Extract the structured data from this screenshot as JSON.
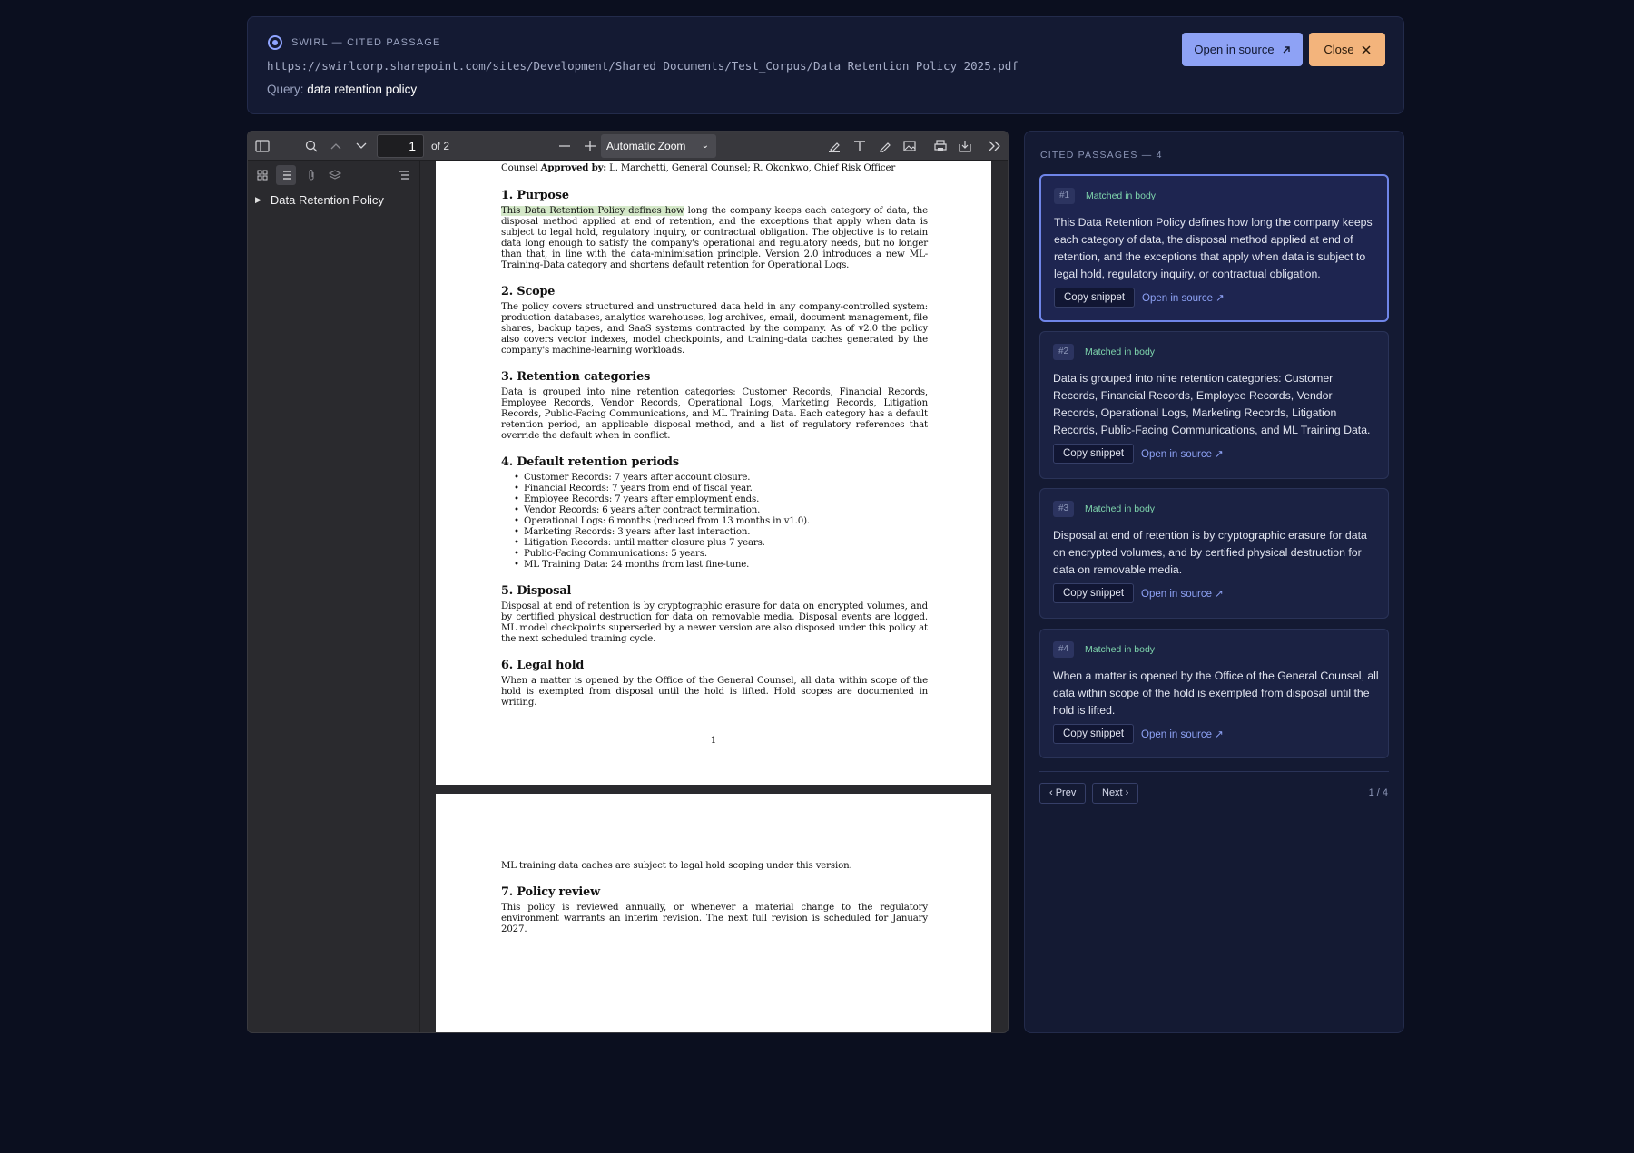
{
  "header": {
    "brand": "SWIRL — CITED PASSAGE",
    "url": "https://swirlcorp.sharepoint.com/sites/Development/Shared Documents/Test_Corpus/Data Retention Policy 2025.pdf",
    "query_label": "Query:",
    "query_value": "data retention policy",
    "open_in_source": "Open in source",
    "close": "Close"
  },
  "viewer": {
    "page_number": "1",
    "page_of": "of 2",
    "zoom": "Automatic Zoom",
    "outline": [
      "Data Retention Policy"
    ]
  },
  "pdf": {
    "page1_top_line": "Counsel",
    "page1_top_bold": "Approved by:",
    "page1_top_rest": " L. Marchetti, General Counsel; R. Okonkwo, Chief Risk Officer",
    "sections": [
      {
        "heading": "1.  Purpose",
        "highlight": "This Data Retention Policy defines how",
        "text": " long the company keeps each category of data, the disposal method applied at end of retention, and the exceptions that apply when data is subject to legal hold, regulatory inquiry, or contractual obligation.  The objective is to retain data long enough to satisfy the company's operational and regulatory needs, but no longer than that, in line with the data-minimisation principle.  Version 2.0 introduces a new ML-Training-Data category and shortens default retention for Operational Logs."
      },
      {
        "heading": "2.  Scope",
        "text": "The policy covers structured and unstructured data held in any company-controlled system: production databases, analytics warehouses, log archives, email, document management, file shares, backup tapes, and SaaS systems contracted by the company.  As of v2.0 the policy also covers vector indexes, model checkpoints, and training-data caches generated by the company's machine-learning workloads."
      },
      {
        "heading": "3.  Retention categories",
        "text": "Data is grouped into nine retention categories:  Customer Records, Financial Records, Employee Records, Vendor Records, Operational Logs, Marketing Records, Litigation Records, Public-Facing Communications, and ML Training Data.  Each category has a default retention period, an applicable disposal method, and a list of regulatory references that override the default when in conflict."
      },
      {
        "heading": "4.  Default retention periods",
        "bullets": [
          "Customer Records: 7 years after account closure.",
          "Financial Records: 7 years from end of fiscal year.",
          "Employee Records: 7 years after employment ends.",
          "Vendor Records: 6 years after contract termination.",
          "Operational Logs: 6 months (reduced from 13 months in v1.0).",
          "Marketing Records: 3 years after last interaction.",
          "Litigation Records: until matter closure plus 7 years.",
          "Public-Facing Communications: 5 years.",
          "ML Training Data: 24 months from last fine-tune."
        ]
      },
      {
        "heading": "5.  Disposal",
        "text": "Disposal at end of retention is by cryptographic erasure for data on encrypted volumes, and by certified physical destruction for data on removable media.  Disposal events are logged.  ML model checkpoints superseded by a newer version are also disposed under this policy at the next scheduled training cycle."
      },
      {
        "heading": "6.  Legal hold",
        "text": "When a matter is opened by the Office of the General Counsel, all data within scope of the hold is exempted from disposal until the hold is lifted.  Hold scopes are documented in writing."
      }
    ],
    "page1_number": "1",
    "page2_intro": "ML training data caches are subject to legal hold scoping under this version.",
    "page2_heading": "7.  Policy review",
    "page2_text": "This policy is reviewed annually, or whenever a material change to the regulatory environment warrants an interim revision.  The next full revision is scheduled for January 2027."
  },
  "panel": {
    "title": "CITED PASSAGES — 4",
    "passages": [
      {
        "num": "#1",
        "match": "Matched in body",
        "text": "This Data Retention Policy defines how long the company keeps each category of data, the disposal method applied at end of retention, and the exceptions that apply when data is subject to legal hold, regulatory inquiry, or contractual obligation.",
        "copy": "Copy snippet",
        "open": "Open in source ↗"
      },
      {
        "num": "#2",
        "match": "Matched in body",
        "text": "Data is grouped into nine retention categories: Customer Records, Financial Records, Employee Records, Vendor Records, Operational Logs, Marketing Records, Litigation Records, Public-Facing Communications, and ML Training Data.",
        "copy": "Copy snippet",
        "open": "Open in source ↗"
      },
      {
        "num": "#3",
        "match": "Matched in body",
        "text": "Disposal at end of retention is by cryptographic erasure for data on encrypted volumes, and by certified physical destruction for data on removable media.",
        "copy": "Copy snippet",
        "open": "Open in source ↗"
      },
      {
        "num": "#4",
        "match": "Matched in body",
        "text": "When a matter is opened by the Office of the General Counsel, all data within scope of the hold is exempted from disposal until the hold is lifted.",
        "copy": "Copy snippet",
        "open": "Open in source ↗"
      }
    ],
    "prev": "‹ Prev",
    "next": "Next ›",
    "counter": "1 / 4"
  },
  "icons": {
    "brand": "swirl-logo-icon",
    "open_external": "arrow-up-right-icon",
    "close": "x-icon"
  },
  "colors": {
    "background": "#0b0f1f",
    "accent": "#8ea2f5",
    "close_button": "#f3b47c",
    "match_green": "#7fd6ad"
  }
}
